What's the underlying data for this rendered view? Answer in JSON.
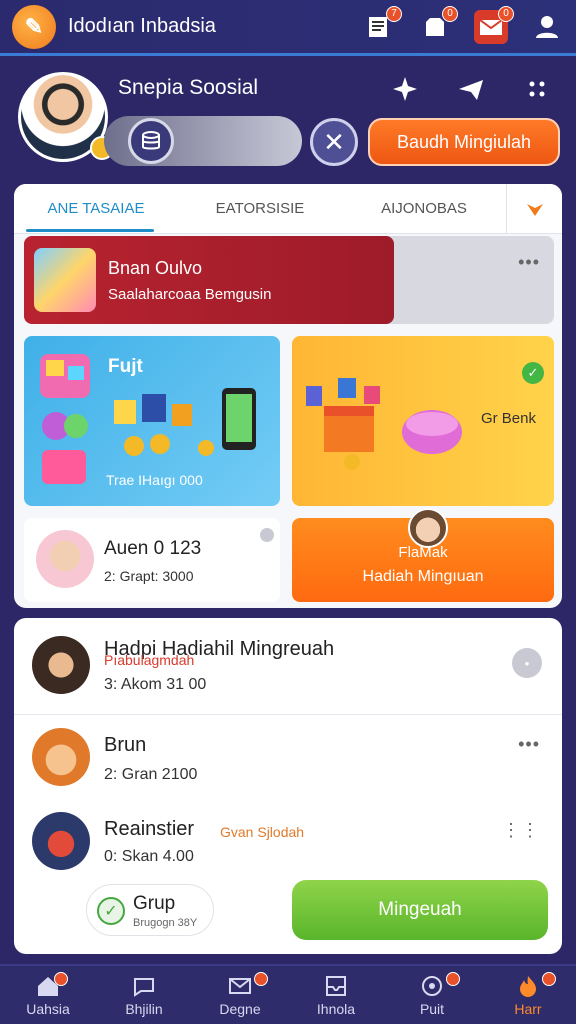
{
  "header": {
    "title": "Idodıan Inbadsia",
    "badges": [
      "7",
      "0",
      "0"
    ]
  },
  "profile": {
    "name": "Snepia Soosial",
    "action_button": "Baudh Mingiulah"
  },
  "tabs": [
    "ANE TASAIAE",
    "EATORSISIE",
    "AIJONOBAS"
  ],
  "featured": {
    "title": "Bnan Oulvo",
    "subtitle": "Saalaharcoaa Bemgusin"
  },
  "tiles": {
    "blue": {
      "title": "Fujt",
      "subtitle": "Trae IHaıgı 000"
    },
    "yellow": {
      "label": "Gr Benk"
    },
    "white": {
      "title": "Auen 0 123",
      "subtitle": "2: Grapt: 3000"
    },
    "orange": {
      "line1": "FlaMak",
      "line2": "Hadiah Mingıuan"
    }
  },
  "list": [
    {
      "title": "Hadpi Hadiahil Mingreuah",
      "sub": "3: Akom 31 00",
      "accent": "Pıabulagmdah"
    },
    {
      "title": "Brun",
      "sub": "2: Gran 2100"
    },
    {
      "title": "Reainstier",
      "sub": "0: Skan 4.00",
      "accent": "Gvan Sjlodah"
    }
  ],
  "group_chip": {
    "title": "Grup",
    "sub": "Brugogn 38Y"
  },
  "green_button": "Mingeuah",
  "nav": [
    "Uahsia",
    "Bhjilin",
    "Degne",
    "Ihnola",
    "Puit",
    "Harr"
  ],
  "colors": {
    "accent": "#ff6a10",
    "primary": "#2d2768",
    "green": "#59b52b",
    "red": "#b8232f"
  }
}
